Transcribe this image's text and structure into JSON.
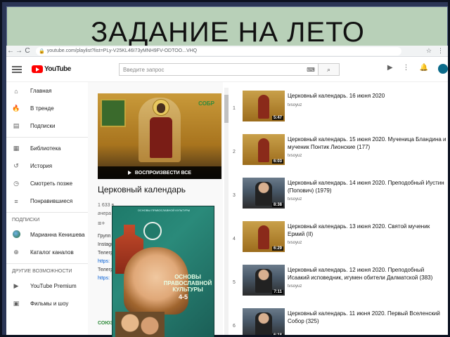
{
  "slide": {
    "title": "ЗАДАНИЕ НА ЛЕТО"
  },
  "browser": {
    "back": "←",
    "forward": "→",
    "reload": "C",
    "url": "youtube.com/playlist?list=PLy-V25KL46I73yMNH9FV-ODTOO...VHQ",
    "tools": [
      "☆",
      "⋮"
    ]
  },
  "header": {
    "logo_text": "YouTube",
    "search_placeholder": "Введите запрос"
  },
  "sidebar": {
    "main": [
      {
        "icon": "⌂",
        "label": "Главная"
      },
      {
        "icon": "🔥",
        "label": "В тренде"
      },
      {
        "icon": "▤",
        "label": "Подписки"
      }
    ],
    "library": [
      {
        "icon": "▦",
        "label": "Библиотека"
      },
      {
        "icon": "↺",
        "label": "История"
      },
      {
        "icon": "◷",
        "label": "Смотреть позже"
      },
      {
        "icon": "≡",
        "label": "Понравившиеся"
      }
    ],
    "subs_heading": "ПОДПИСКИ",
    "subs": [
      {
        "label": "Марианна Кенишева"
      },
      {
        "icon": "⊕",
        "label": "Каталог каналов"
      }
    ],
    "other_heading": "ДРУГИЕ ВОЗМОЖНОСТИ",
    "other": [
      {
        "icon": "▶",
        "label": "YouTube Premium"
      },
      {
        "icon": "▣",
        "label": "Фильмы и шоу"
      }
    ]
  },
  "playlist": {
    "logo": "СОБР",
    "play_all": "ВОСПРОИЗВЕСТИ ВСЕ",
    "title": "Церковный календарь",
    "meta_1": "1 633 в",
    "meta_2": "ачера",
    "share": "≡+",
    "desc_lines": [
      "Групп",
      "Instagr",
      "Телегр"
    ],
    "desc_link_1": "https:",
    "desc_line_4": "Телегр",
    "desc_link_2": "https:",
    "footer_logo": "СОЮЗ"
  },
  "book": {
    "top_text": "ОСНОВЫ ПРАВОСЛАВНОЙ КУЛЬТУРЫ",
    "title": "ОСНОВЫ ПРАВОСЛАВНОЙ КУЛЬТУРЫ",
    "grade": "4-5"
  },
  "videos": [
    {
      "num": "1",
      "title": "Церковный календарь. 16 июня 2020",
      "channel": "tvsoyuz",
      "duration": "5:47",
      "thumb": "icon"
    },
    {
      "num": "2",
      "title": "Церковный календарь. 15 июня 2020. Мученица Бландина и мученик Понтик Лионские (177)",
      "channel": "tvsoyuz",
      "duration": "6:03",
      "thumb": "icon"
    },
    {
      "num": "3",
      "title": "Церковный календарь. 14 июня 2020. Преподобный Иустин (Попович) (1979)",
      "channel": "tvsoyuz",
      "duration": "8:38",
      "thumb": "priest"
    },
    {
      "num": "4",
      "title": "Церковный календарь. 13 июня 2020. Святой мученик Ермий (II)",
      "channel": "tvsoyuz",
      "duration": "6:29",
      "thumb": "icon"
    },
    {
      "num": "5",
      "title": "Церковный календарь. 12 июня 2020. Преподобный Исаакий исповедник, игумен обители Далматской (383)",
      "channel": "tvsoyuz",
      "duration": "7:11",
      "thumb": "priest"
    },
    {
      "num": "6",
      "title": "Церковный календарь. 11 июня 2020. Первый Вселенский Собор (325)",
      "channel": "",
      "duration": "6:18",
      "thumb": "priest"
    }
  ]
}
